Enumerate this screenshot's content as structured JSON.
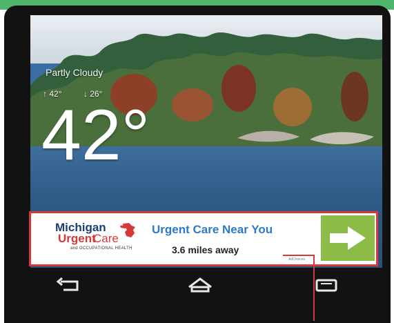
{
  "weather": {
    "condition": "Partly Cloudy",
    "high": "42°",
    "low": "26°",
    "current": "42°"
  },
  "ad": {
    "brand_top": "Michigan",
    "brand_main": "Urgent",
    "brand_main2": "Care",
    "brand_small": "and OCCUPATIONAL HEALTH",
    "headline": "Urgent Care Near You",
    "distance": "3.6 miles away",
    "adchoices": "AdChoices"
  },
  "colors": {
    "top_bar": "#4fb56a",
    "ad_border": "#d5393a",
    "ad_title": "#2b79c7",
    "ad_button": "#8dbb48"
  },
  "icons": {
    "ad_action": "arrow-right-icon",
    "nav_back": "back-icon",
    "nav_home": "home-icon",
    "nav_recents": "recent-apps-icon"
  }
}
